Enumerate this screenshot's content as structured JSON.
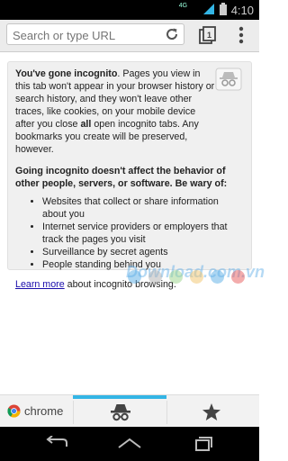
{
  "status_bar": {
    "network": "4G",
    "time": "4:10"
  },
  "omnibox": {
    "placeholder": "Search or type URL"
  },
  "incognito": {
    "intro_title": "You've gone incognito",
    "intro_text_1": ". Pages you view in this tab won't appear in your browser history or search history, and they won't leave other traces, like cookies, on your mobile device after you close ",
    "intro_bold": "all",
    "intro_text_2": " open incognito tabs. Any bookmarks you create will be preserved, however.",
    "warning": "Going incognito doesn't affect the behavior of other people, servers, or software. Be wary of:",
    "items": [
      "Websites that collect or share information about you",
      "Internet service providers or employers that track the pages you visit",
      "Surveillance by secret agents",
      "People standing behind you"
    ],
    "learn_more": "Learn more",
    "learn_more_suffix": " about incognito browsing."
  },
  "watermark": {
    "text": "Download.com.vn",
    "dot_colors": [
      "#5aaee6",
      "#b0b0b0",
      "#9ad48a",
      "#f2c46a",
      "#5aaee6",
      "#e85a5a"
    ]
  },
  "bottom_bar": {
    "chrome_label": "chrome"
  },
  "colors": {
    "accent": "#33b5e5",
    "link": "#1a0dab"
  }
}
